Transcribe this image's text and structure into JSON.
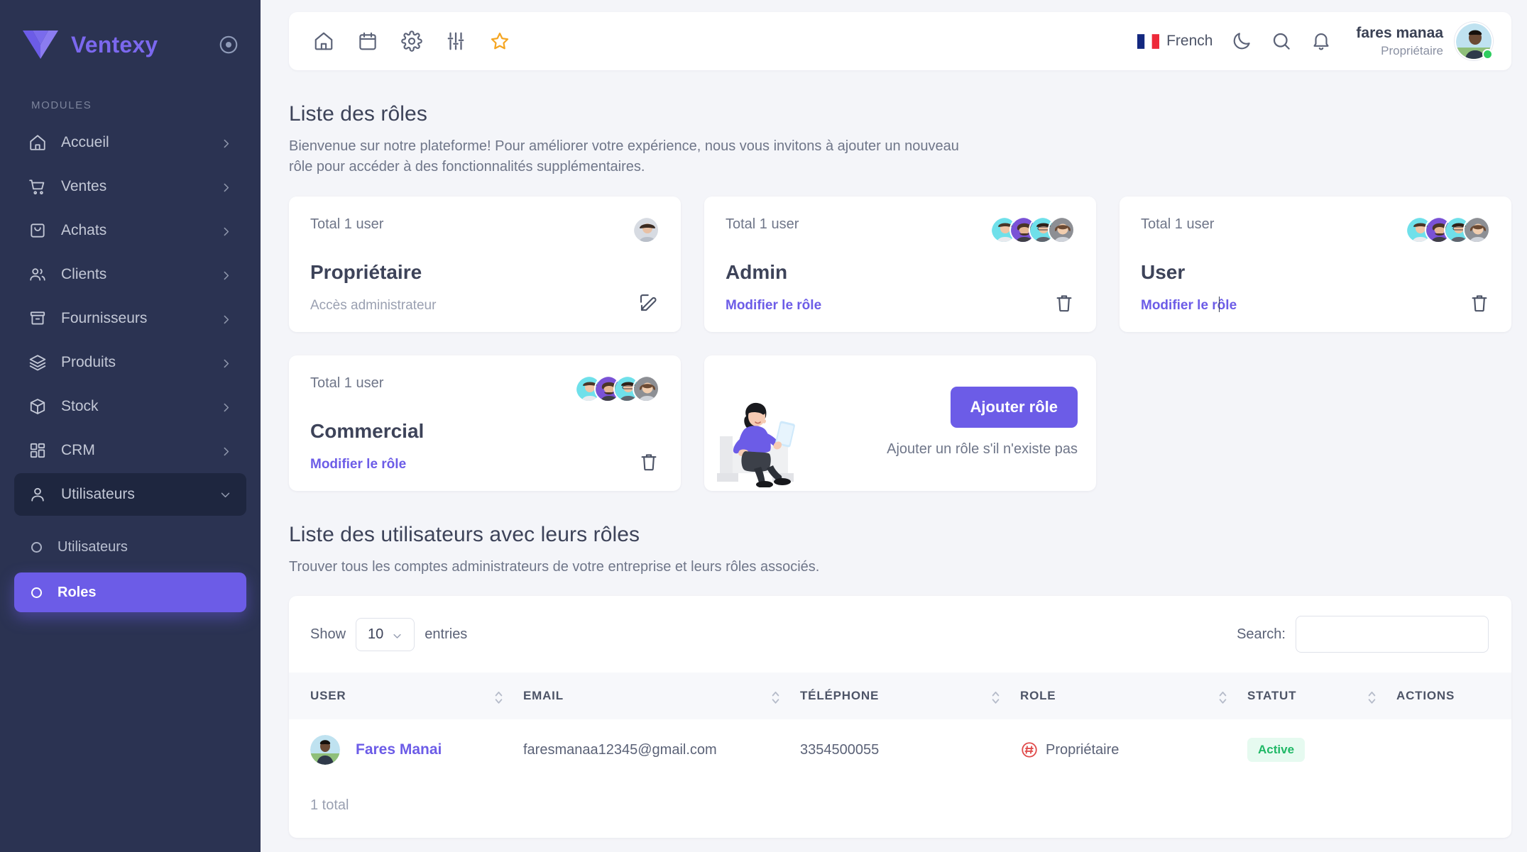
{
  "brand": {
    "name": "Ventexy",
    "logo_icon": "ventexy-logo-icon",
    "toggle_icon": "target-circle-icon"
  },
  "sidebar": {
    "section_label": "MODULES",
    "items": [
      {
        "label": "Accueil",
        "icon": "home-icon"
      },
      {
        "label": "Ventes",
        "icon": "shopping-cart-icon"
      },
      {
        "label": "Achats",
        "icon": "shopping-bag-icon"
      },
      {
        "label": "Clients",
        "icon": "users-icon"
      },
      {
        "label": "Fournisseurs",
        "icon": "archive-box-icon"
      },
      {
        "label": "Produits",
        "icon": "layers-icon"
      },
      {
        "label": "Stock",
        "icon": "package-icon"
      },
      {
        "label": "CRM",
        "icon": "grid-icon"
      },
      {
        "label": "Utilisateurs",
        "icon": "user-icon",
        "open": true
      }
    ],
    "subitems": [
      {
        "label": "Utilisateurs",
        "active": false
      },
      {
        "label": "Roles",
        "active": true
      }
    ]
  },
  "topbar": {
    "icons": [
      "home-icon",
      "calendar-icon",
      "gear-icon",
      "sliders-icon",
      "star-icon"
    ],
    "language": "French",
    "theme_icon": "moon-icon",
    "search_icon": "search-icon",
    "notifications_icon": "bell-icon",
    "user_name": "fares manaa",
    "user_role": "Propriétaire",
    "status_color": "#2ecc5f"
  },
  "roles_section": {
    "title": "Liste des rôles",
    "description": "Bienvenue sur notre plateforme! Pour améliorer votre expérience, nous vous invitons à ajouter un nouveau rôle pour accéder à des fonctionnalités supplémentaires.",
    "cards": [
      {
        "total": "Total 1 user",
        "name": "Propriétaire",
        "desc": "Accès administrateur",
        "link": "",
        "action_icon": "edit-pencil-icon",
        "avatars": 1
      },
      {
        "total": "Total 1 user",
        "name": "Admin",
        "desc": "",
        "link": "Modifier le rôle",
        "action_icon": "trash-icon",
        "avatars": 4
      },
      {
        "total": "Total 1 user",
        "name": "User",
        "desc": "",
        "link": "Modifier le rôle",
        "action_icon": "trash-icon",
        "avatars": 4,
        "caret": true
      },
      {
        "total": "Total 1 user",
        "name": "Commercial",
        "desc": "",
        "link": "Modifier le rôle",
        "action_icon": "trash-icon",
        "avatars": 4
      }
    ],
    "add_card": {
      "button_label": "Ajouter rôle",
      "description": "Ajouter un rôle s'il n'existe pas",
      "illustration": "woman-sitting-with-tablet-illustration",
      "accent_color": "#6c5ce7"
    }
  },
  "users_section": {
    "title": "Liste des utilisateurs avec leurs rôles",
    "description": "Trouver tous les comptes administrateurs de votre entreprise et leurs rôles associés.",
    "show_label": "Show",
    "show_value": "10",
    "entries_label": "entries",
    "search_label": "Search:",
    "search_value": "",
    "search_placeholder": "",
    "columns": [
      "USER",
      "EMAIL",
      "TÉLÉPHONE",
      "ROLE",
      "STATUT",
      "ACTIONS"
    ],
    "rows": [
      {
        "user": "Fares Manai",
        "email": "faresmanaa12345@gmail.com",
        "phone": "3354500055",
        "role": "Propriétaire",
        "role_icon": "role-badge-icon",
        "statut": "Active",
        "statut_color": "#1fb866",
        "actions": ""
      }
    ],
    "footer": "1 total"
  }
}
